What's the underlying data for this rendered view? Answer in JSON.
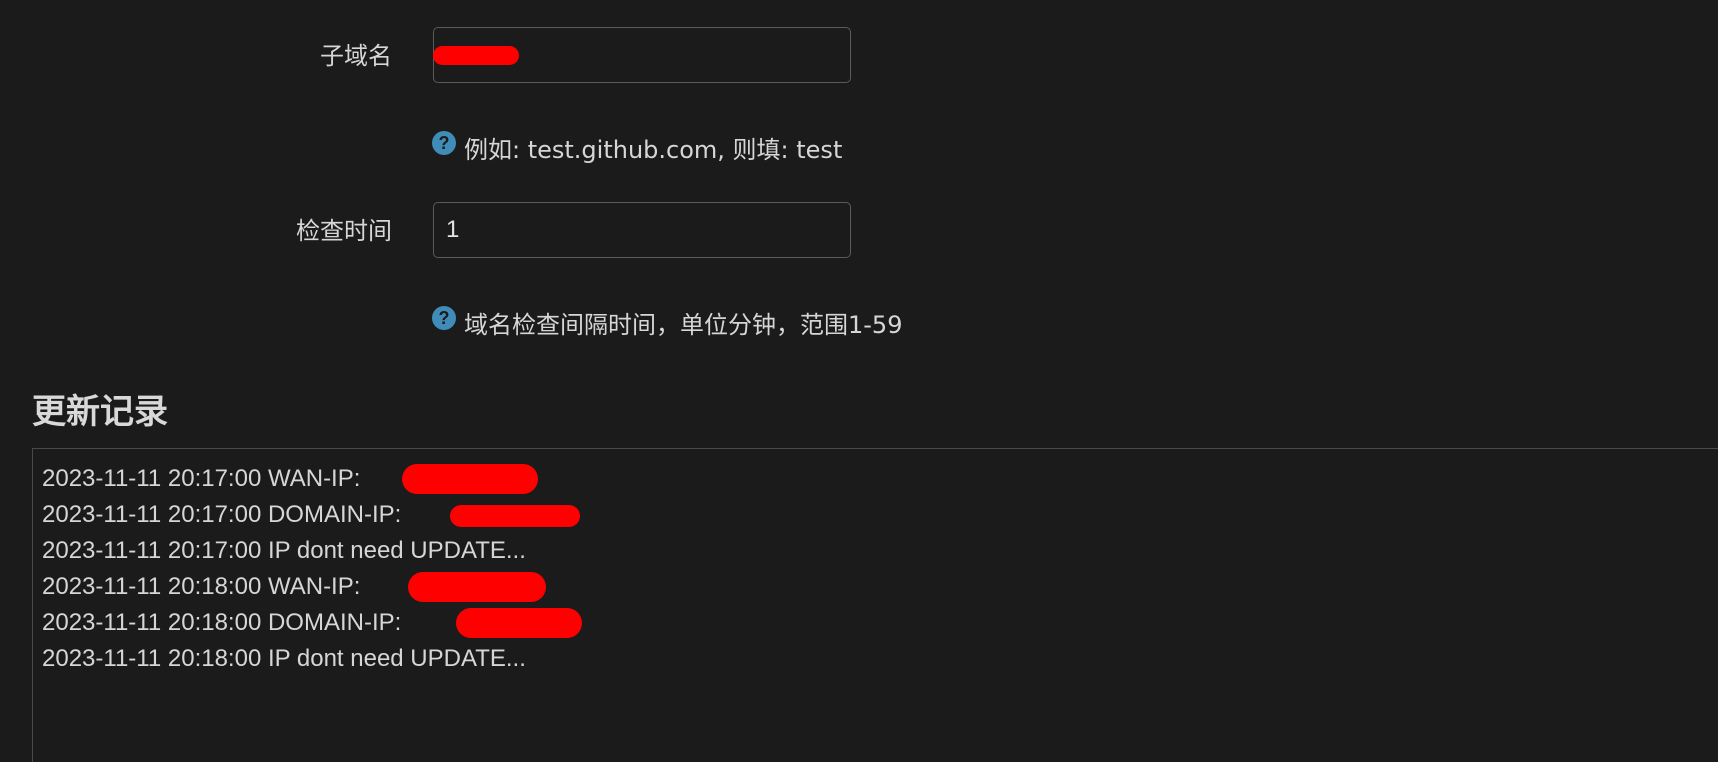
{
  "form": {
    "subdomain": {
      "label": "子域名",
      "value": "",
      "hint": "例如: test.github.com, 则填: test"
    },
    "check_interval": {
      "label": "检查时间",
      "value": "1",
      "hint": "域名检查间隔时间，单位分钟，范围1-59"
    }
  },
  "update_log": {
    "title": "更新记录",
    "lines": [
      "2023-11-11 20:17:00 WAN-IP: ",
      "2023-11-11 20:17:00 DOMAIN-IP: ",
      "2023-11-11 20:17:00 IP dont need UPDATE...",
      "2023-11-11 20:18:00 WAN-IP: ",
      "2023-11-11 20:18:00 DOMAIN-IP: ",
      "2023-11-11 20:18:00 IP dont need UPDATE..."
    ]
  },
  "icons": {
    "help": "help-question-icon"
  },
  "colors": {
    "background": "#1b1b1b",
    "text": "#d6d6d6",
    "input_border": "#5a5a5a",
    "help_icon": "#3f8cb8",
    "redaction": "#ff0000"
  }
}
